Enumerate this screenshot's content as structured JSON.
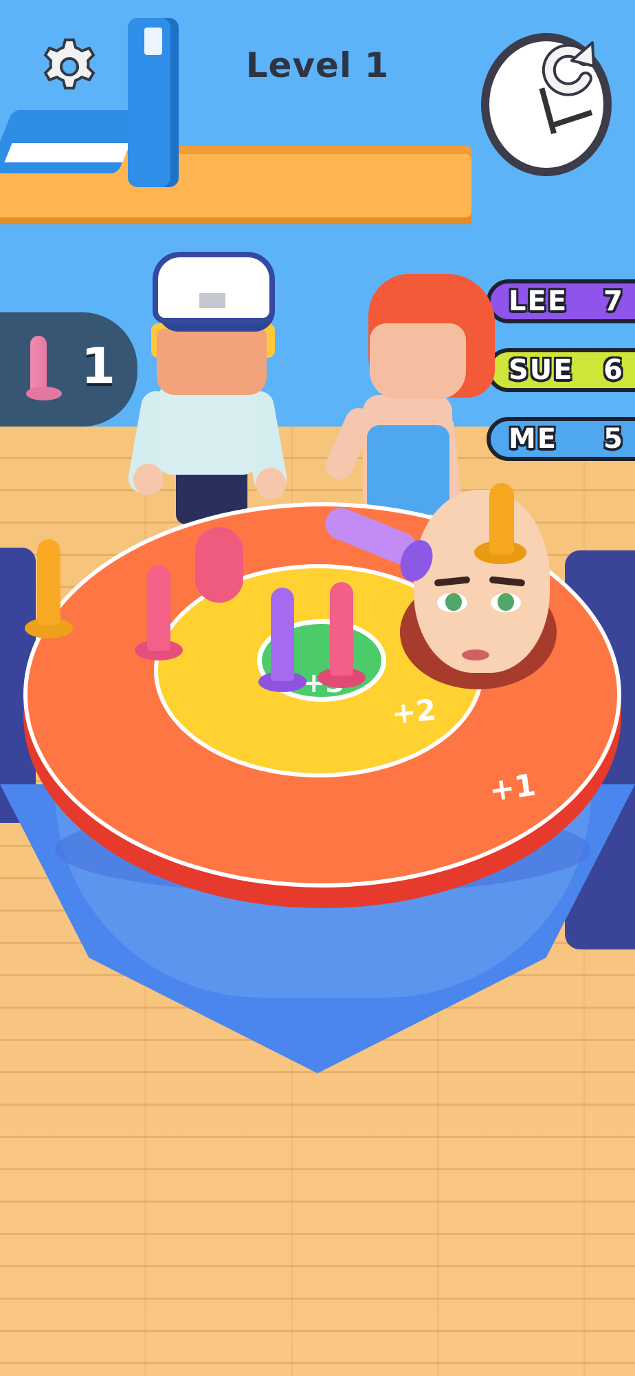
{
  "header": {
    "level_title": "Level 1"
  },
  "hud": {
    "remaining_pegs": "1",
    "settings_icon": "gear-icon",
    "restart_icon": "restart-icon"
  },
  "scoreboard": [
    {
      "name": "LEE",
      "score": "7",
      "color": "#8f54ec"
    },
    {
      "name": "SUE",
      "score": "6",
      "color": "#cfe539"
    },
    {
      "name": "ME",
      "score": "5",
      "color": "#4ea7ef"
    }
  ],
  "board": {
    "ring_labels": {
      "outer": "+1",
      "middle": "+2",
      "center": "+3"
    }
  },
  "colors": {
    "wall": "#5db3f7",
    "board_outer": "#ff7645",
    "board_middle": "#ffd232",
    "board_center": "#4bcb6a"
  }
}
